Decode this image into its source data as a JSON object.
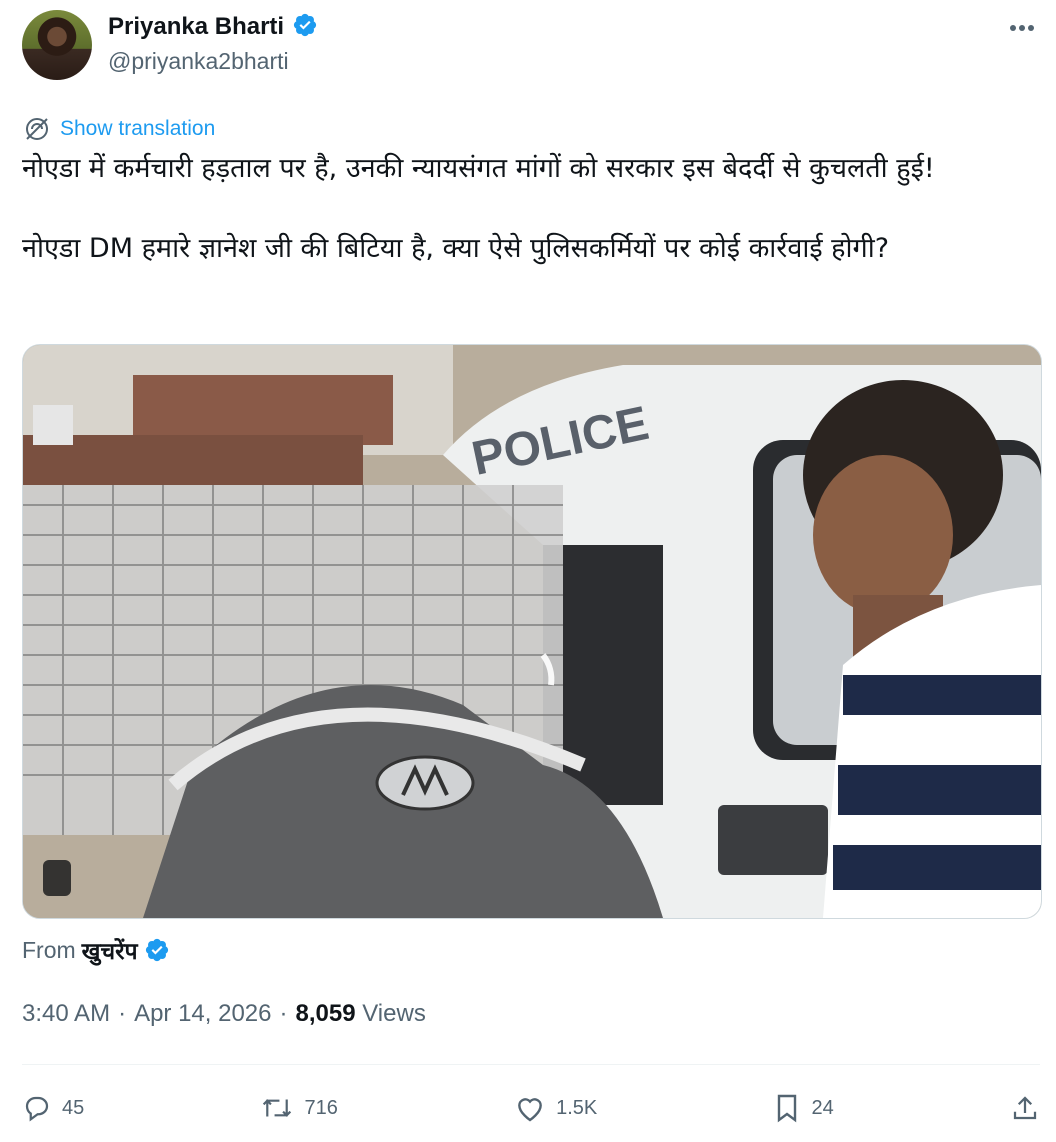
{
  "author": {
    "name": "Priyanka Bharti",
    "handle": "@priyanka2bharti",
    "verified": true
  },
  "translate_label": "Show translation",
  "tweet_text": "नोएडा में कर्मचारी हड़ताल पर है, उनकी न्यायसंगत मांगों को सरकार इस बेदर्दी से कुचलती हुई!\n\nनोएडा DM हमारे ज्ञानेश जी की बिटिया है, क्या ऐसे पुलिसकर्मियों पर कोई कार्रवाई होगी?",
  "media": {
    "vehicle_text": "POLICE"
  },
  "source": {
    "prefix": "From",
    "name": "खुचरेंप",
    "verified": true
  },
  "meta": {
    "time": "3:40 AM",
    "separator": "·",
    "date": "Apr 14, 2026",
    "views_count": "8,059",
    "views_label": "Views"
  },
  "actions": {
    "replies": "45",
    "reposts": "716",
    "likes": "1.5K",
    "bookmarks": "24"
  },
  "colors": {
    "accent": "#1d9bf0",
    "muted": "#536471",
    "text": "#0f1419"
  }
}
